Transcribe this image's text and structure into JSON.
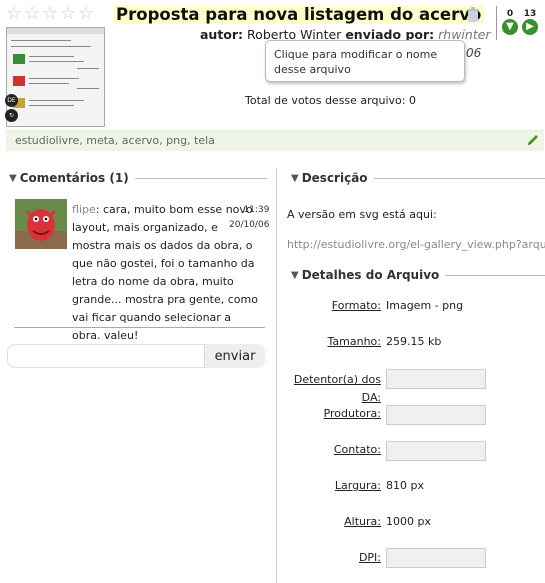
{
  "header": {
    "rating_stars": 5,
    "rating_value": 0,
    "title": "Proposta para nova listagem do acervo",
    "author_label": "autor:",
    "author_name": "Roberto Winter",
    "sent_by_label": "enviado por:",
    "sent_by_user": "rhwinter",
    "date_fragment": "06",
    "tooltip": "Clique para modificar o nome desse arquivo",
    "votes_total": "Total de votos desse arquivo: 0",
    "vote_down_count": "0",
    "vote_up_count": "13",
    "thumb_icons": [
      "DE",
      "↻"
    ]
  },
  "tags": {
    "items": [
      "estudiolivre",
      "meta",
      "acervo",
      "png",
      "tela"
    ],
    "separator": ", "
  },
  "comments": {
    "heading": "Comentários (1)",
    "items": [
      {
        "user": "flipe",
        "text": ": cara, muito bom esse novo layout, mais organizado, e mostra mais os dados da obra, o que não gostei, foi o tamanho da letra do nome da obra, muito grande... mostra pra gente, como vai ficar quando selecionar a obra. valeu!",
        "time": "11:39",
        "date": "20/10/06"
      }
    ],
    "input_placeholder": "",
    "send_label": "enviar"
  },
  "description": {
    "heading": "Descrição",
    "text": "A versão em svg está aqui:",
    "url": "http://estudiolivre.org/el-gallery_view.php?arqui"
  },
  "details": {
    "heading": "Detalhes do Arquivo",
    "rows": [
      {
        "label": "Formato:",
        "value": "Imagem - png"
      },
      {
        "label": "Tamanho:",
        "value": "259.15 kb"
      },
      {
        "label": "Detentor(a) dos DA:",
        "value": ""
      },
      {
        "label": "Produtora:",
        "value": ""
      },
      {
        "label": "Contato:",
        "value": ""
      },
      {
        "label": "Largura:",
        "value": "810 px"
      },
      {
        "label": "Altura:",
        "value": "1000 px"
      },
      {
        "label": "DPI:",
        "value": ""
      }
    ]
  },
  "colors": {
    "accent_green": "#3a8f2e",
    "tagbar_bg": "#eef5e6",
    "title_highlight": "#ffffcc"
  }
}
